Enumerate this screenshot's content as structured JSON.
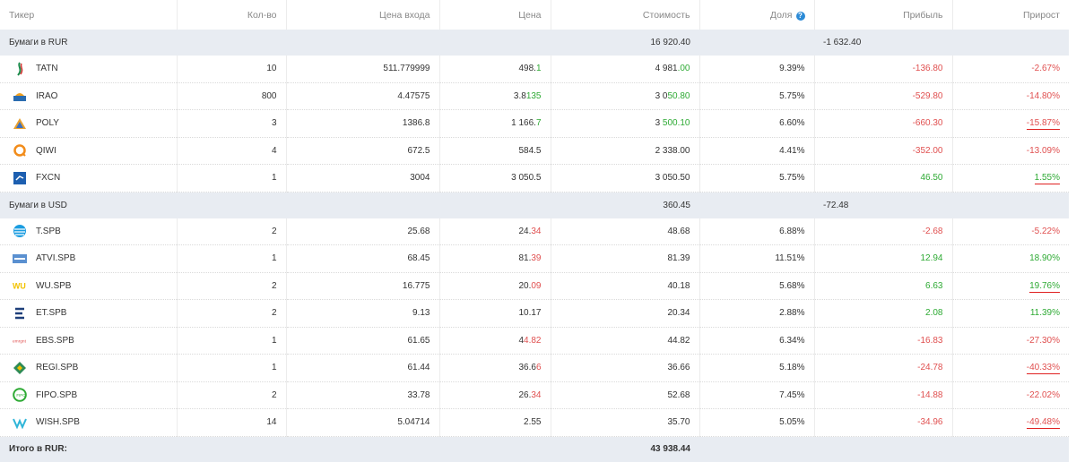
{
  "headers": {
    "ticker": "Тикер",
    "qty": "Кол-во",
    "entry_price": "Цена входа",
    "price": "Цена",
    "value": "Стоимость",
    "share": "Доля",
    "profit": "Прибыль",
    "growth": "Прирост"
  },
  "help_icon": "question-circle-icon",
  "groups": [
    {
      "label": "Бумаги в RUR",
      "value": "16 920.40",
      "profit": "-1 632.40"
    },
    {
      "label": "Бумаги в USD",
      "value": "360.45",
      "profit": "-72.48"
    }
  ],
  "rur_rows": [
    {
      "ticker": "TATN",
      "icon": "tatneft-logo-icon",
      "qty": "10",
      "entry": "511.779999",
      "price_a": "498.",
      "price_b": "1",
      "price_dir": "pos",
      "value_a": "4 981",
      "value_b": ".00",
      "value_dir": "pos",
      "share": "9.39%",
      "profit": "-136.80",
      "profit_dir": "neg",
      "growth": "-2.67%",
      "growth_dir": "neg",
      "underlined": false
    },
    {
      "ticker": "IRAO",
      "icon": "inter-rao-logo-icon",
      "qty": "800",
      "entry": "4.47575",
      "price_a": "3.8",
      "price_b": "135",
      "price_dir": "pos",
      "value_a": "3 0",
      "value_b": "50.80",
      "value_dir": "pos",
      "share": "5.75%",
      "profit": "-529.80",
      "profit_dir": "neg",
      "growth": "-14.80%",
      "growth_dir": "neg",
      "underlined": false
    },
    {
      "ticker": "POLY",
      "icon": "polymetal-logo-icon",
      "qty": "3",
      "entry": "1386.8",
      "price_a": "1 166.",
      "price_b": "7",
      "price_dir": "pos",
      "value_a": "3 ",
      "value_b": "500.10",
      "value_dir": "pos",
      "share": "6.60%",
      "profit": "-660.30",
      "profit_dir": "neg",
      "growth": "-15.87%",
      "growth_dir": "neg",
      "underlined": true
    },
    {
      "ticker": "QIWI",
      "icon": "qiwi-logo-icon",
      "qty": "4",
      "entry": "672.5",
      "price_a": "584.5",
      "price_b": "",
      "price_dir": "none",
      "value_a": "2 338.00",
      "value_b": "",
      "value_dir": "none",
      "share": "4.41%",
      "profit": "-352.00",
      "profit_dir": "neg",
      "growth": "-13.09%",
      "growth_dir": "neg",
      "underlined": false
    },
    {
      "ticker": "FXCN",
      "icon": "finex-logo-icon",
      "qty": "1",
      "entry": "3004",
      "price_a": "3 050.5",
      "price_b": "",
      "price_dir": "none",
      "value_a": "3 050.50",
      "value_b": "",
      "value_dir": "none",
      "share": "5.75%",
      "profit": "46.50",
      "profit_dir": "pos",
      "growth": "1.55%",
      "growth_dir": "pos",
      "underlined": true
    }
  ],
  "usd_rows": [
    {
      "ticker": "T.SPB",
      "icon": "att-logo-icon",
      "qty": "2",
      "entry": "25.68",
      "price_a": "24.",
      "price_b": "34",
      "price_dir": "neg",
      "value_a": "48.68",
      "value_b": "",
      "value_dir": "none",
      "share": "6.88%",
      "profit": "-2.68",
      "profit_dir": "neg",
      "growth": "-5.22%",
      "growth_dir": "neg",
      "underlined": false
    },
    {
      "ticker": "ATVI.SPB",
      "icon": "activision-logo-icon",
      "qty": "1",
      "entry": "68.45",
      "price_a": "81.",
      "price_b": "39",
      "price_dir": "neg",
      "value_a": "81.39",
      "value_b": "",
      "value_dir": "none",
      "share": "11.51%",
      "profit": "12.94",
      "profit_dir": "pos",
      "growth": "18.90%",
      "growth_dir": "pos",
      "underlined": false
    },
    {
      "ticker": "WU.SPB",
      "icon": "western-union-logo-icon",
      "qty": "2",
      "entry": "16.775",
      "price_a": "20.",
      "price_b": "09",
      "price_dir": "neg",
      "value_a": "40.18",
      "value_b": "",
      "value_dir": "none",
      "share": "5.68%",
      "profit": "6.63",
      "profit_dir": "pos",
      "growth": "19.76%",
      "growth_dir": "pos",
      "underlined": true
    },
    {
      "ticker": "ET.SPB",
      "icon": "energy-transfer-logo-icon",
      "qty": "2",
      "entry": "9.13",
      "price_a": "10.17",
      "price_b": "",
      "price_dir": "none",
      "value_a": "20.34",
      "value_b": "",
      "value_dir": "none",
      "share": "2.88%",
      "profit": "2.08",
      "profit_dir": "pos",
      "growth": "11.39%",
      "growth_dir": "pos",
      "underlined": false
    },
    {
      "ticker": "EBS.SPB",
      "icon": "emergent-logo-icon",
      "qty": "1",
      "entry": "61.65",
      "price_a": "4",
      "price_b": "4.82",
      "price_dir": "neg",
      "value_a": "44.82",
      "value_b": "",
      "value_dir": "none",
      "share": "6.34%",
      "profit": "-16.83",
      "profit_dir": "neg",
      "growth": "-27.30%",
      "growth_dir": "neg",
      "underlined": false
    },
    {
      "ticker": "REGI.SPB",
      "icon": "regi-logo-icon",
      "qty": "1",
      "entry": "61.44",
      "price_a": "36.6",
      "price_b": "6",
      "price_dir": "neg",
      "value_a": "36.66",
      "value_b": "",
      "value_dir": "none",
      "share": "5.18%",
      "profit": "-24.78",
      "profit_dir": "neg",
      "growth": "-40.33%",
      "growth_dir": "neg",
      "underlined": true
    },
    {
      "ticker": "FIPO.SPB",
      "icon": "fipo-logo-icon",
      "qty": "2",
      "entry": "33.78",
      "price_a": "26.",
      "price_b": "34",
      "price_dir": "neg",
      "value_a": "52.68",
      "value_b": "",
      "value_dir": "none",
      "share": "7.45%",
      "profit": "-14.88",
      "profit_dir": "neg",
      "growth": "-22.02%",
      "growth_dir": "neg",
      "underlined": false
    },
    {
      "ticker": "WISH.SPB",
      "icon": "wish-logo-icon",
      "qty": "14",
      "entry": "5.04714",
      "price_a": "2.55",
      "price_b": "",
      "price_dir": "none",
      "value_a": "35.70",
      "value_b": "",
      "value_dir": "none",
      "share": "5.05%",
      "profit": "-34.96",
      "profit_dir": "neg",
      "growth": "-49.48%",
      "growth_dir": "neg",
      "underlined": true
    }
  ],
  "total": {
    "label": "Итого в RUR:",
    "value": "43 938.44"
  },
  "colors": {
    "positive": "#2eaa34",
    "negative": "#e05050",
    "group_bg": "#e8ecf2",
    "underline": "#e02020"
  }
}
